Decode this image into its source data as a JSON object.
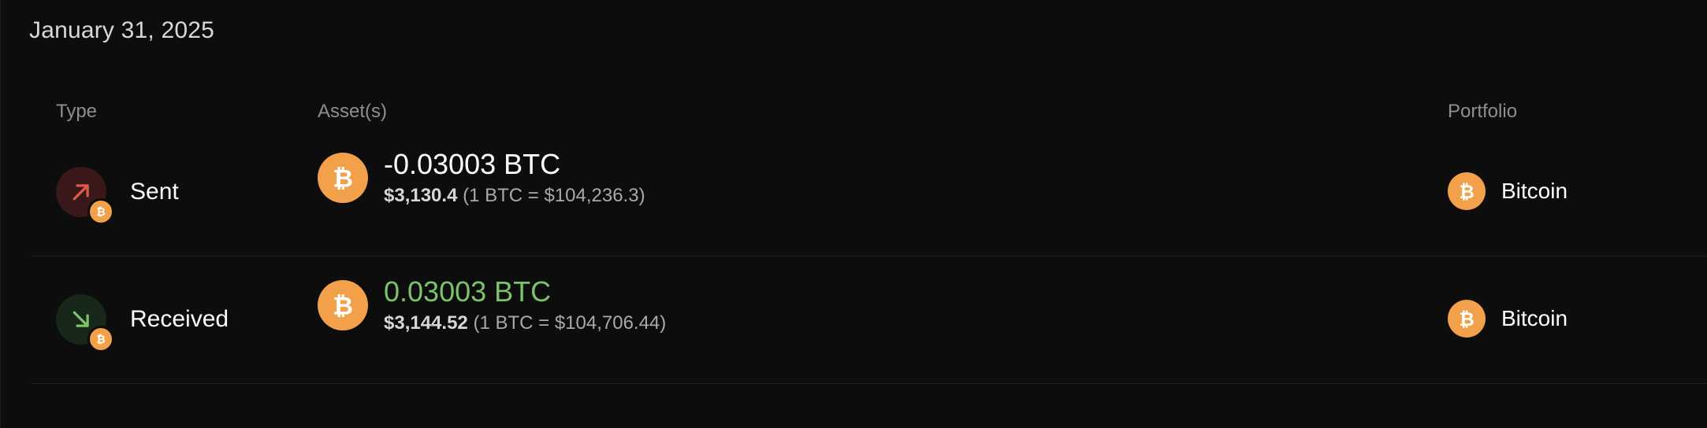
{
  "date_heading": "January 31, 2025",
  "columns": {
    "type": "Type",
    "assets": "Asset(s)",
    "portfolio": "Portfolio"
  },
  "transactions": [
    {
      "type": "Sent",
      "direction_icon": "arrow-up-right-icon",
      "amount": "-0.03003 BTC",
      "fiat_value": "$3,130.4",
      "rate": "(1 BTC = $104,236.3)",
      "portfolio": "Bitcoin"
    },
    {
      "type": "Received",
      "direction_icon": "arrow-down-right-icon",
      "amount": "0.03003 BTC",
      "fiat_value": "$3,144.52",
      "rate": "(1 BTC = $104,706.44)",
      "portfolio": "Bitcoin"
    }
  ],
  "colors": {
    "background": "#0d0d0d",
    "bitcoin_orange": "#f2a04a",
    "sent_red": "#e0584e",
    "received_green": "#7cc26a"
  },
  "icons": {
    "asset": "bitcoin-icon",
    "portfolio": "bitcoin-icon"
  }
}
